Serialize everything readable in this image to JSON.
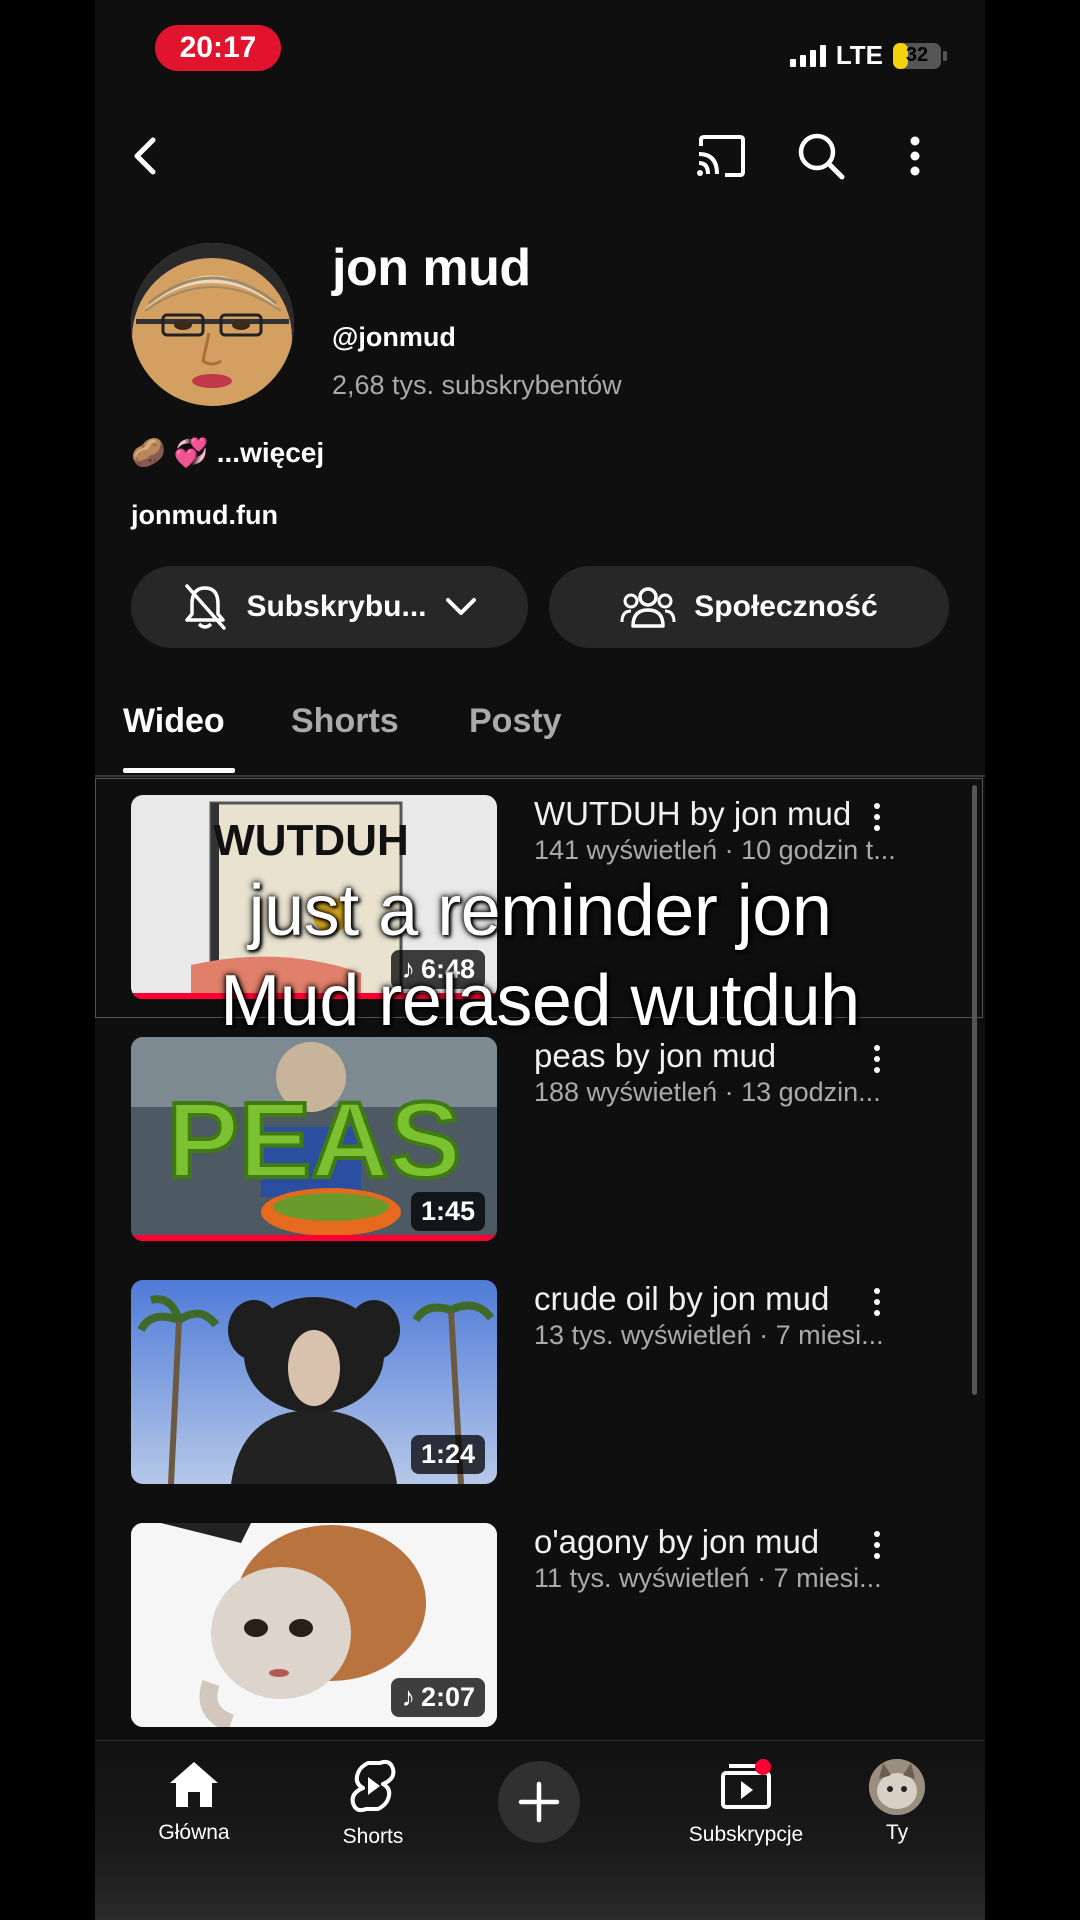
{
  "status_bar": {
    "time": "20:17",
    "network": "LTE",
    "battery": "32",
    "battery_level": 0.32
  },
  "channel": {
    "name": "jon mud",
    "handle": "@jonmud",
    "subscribers": "2,68 tys. subskrybentów",
    "description": "...więcej",
    "description_emojis": [
      "🥔",
      "💞"
    ],
    "link": "jonmud.fun"
  },
  "buttons": {
    "subscribe": "Subskrybu...",
    "community": "Społeczność"
  },
  "tabs": [
    "Wideo",
    "Shorts",
    "Posty"
  ],
  "videos": [
    {
      "title": "WUTDUH by jon mud",
      "meta": "141 wyświetleń · 10 godzin t...",
      "duration": "6:48",
      "music": true,
      "thumb_text": "WUTDUH"
    },
    {
      "title": "peas by jon mud",
      "meta": "188 wyświetleń · 13 godzin...",
      "duration": "1:45",
      "music": false,
      "thumb_text": "PEAS"
    },
    {
      "title": "crude oil by jon mud",
      "meta": "13 tys. wyświetleń · 7 miesi...",
      "duration": "1:24",
      "music": false
    },
    {
      "title": "o'agony by jon mud",
      "meta": "11 tys. wyświetleń · 7 miesi...",
      "duration": "2:07",
      "music": true
    }
  ],
  "overlay_caption": [
    "just a reminder jon",
    "Mud relased wutduh"
  ],
  "bottom_nav": {
    "home": "Główna",
    "shorts": "Shorts",
    "subscriptions": "Subskrypcje",
    "you": "Ty"
  },
  "colors": {
    "accent_red": "#ff0033",
    "time_pill": "#e2142d",
    "background": "#0f0f0f"
  }
}
